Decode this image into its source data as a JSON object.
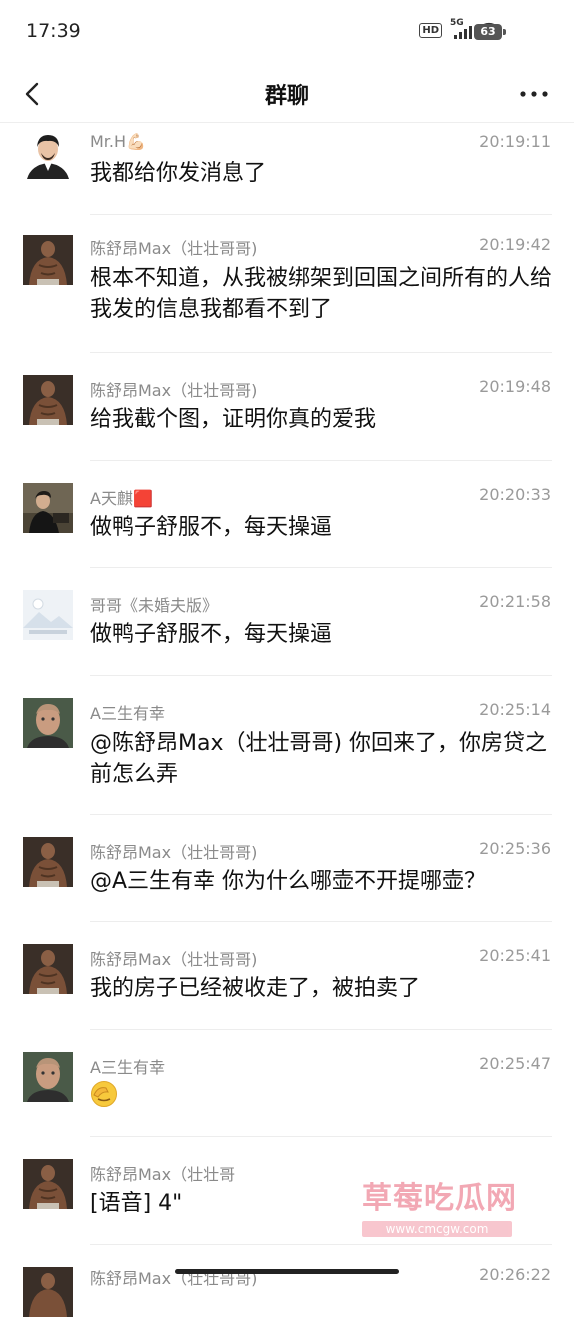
{
  "status_bar": {
    "time": "17:39",
    "hd_label": "HD",
    "network_label": "5G",
    "battery": "63"
  },
  "nav": {
    "title": "群聊",
    "back_icon": "chevron-left-icon",
    "more_icon": "more-dots-icon"
  },
  "messages": [
    {
      "sender": "Mr.H💪🏻",
      "time": "20:19:11",
      "text": "我都给你发消息了",
      "avatar": "mr-h"
    },
    {
      "sender": "陈舒昂Max（壮壮哥哥)",
      "time": "20:19:42",
      "text": "根本不知道，从我被绑架到回国之间所有的人给我发的信息我都看不到了",
      "avatar": "chen"
    },
    {
      "sender": "陈舒昂Max（壮壮哥哥)",
      "time": "20:19:48",
      "text": "给我截个图，证明你真的爱我",
      "avatar": "chen"
    },
    {
      "sender": "A天麒🟥",
      "time": "20:20:33",
      "text": "做鸭子舒服不，每天操逼",
      "avatar": "tianqi"
    },
    {
      "sender": "哥哥《未婚夫版》",
      "time": "20:21:58",
      "text": "做鸭子舒服不，每天操逼",
      "avatar": "gege"
    },
    {
      "sender": "A三生有幸",
      "time": "20:25:14",
      "text": "@陈舒昂Max（壮壮哥哥) 你回来了，你房贷之前怎么弄",
      "avatar": "sansheng"
    },
    {
      "sender": "陈舒昂Max（壮壮哥哥)",
      "time": "20:25:36",
      "text": "@A三生有幸 你为什么哪壶不开提哪壶？",
      "avatar": "chen"
    },
    {
      "sender": "陈舒昂Max（壮壮哥哥)",
      "time": "20:25:41",
      "text": "我的房子已经被收走了，被拍卖了",
      "avatar": "chen"
    },
    {
      "sender": "A三生有幸",
      "time": "20:25:47",
      "text": "",
      "emoji": "facepalm-emoji",
      "avatar": "sansheng"
    },
    {
      "sender": "陈舒昂Max（壮壮哥",
      "time": "",
      "text": "[语音] 4\"",
      "avatar": "chen"
    },
    {
      "sender": "陈舒昂Max（壮壮哥哥)",
      "time": "20:26:22",
      "text": "",
      "avatar": "chen"
    }
  ],
  "watermark": {
    "main": "草莓吃瓜网",
    "url": "www.cmcgw.com"
  },
  "colors": {
    "meta_text": "#8a8a8a",
    "divider": "#ededed",
    "watermark": "#ee8c9b"
  }
}
